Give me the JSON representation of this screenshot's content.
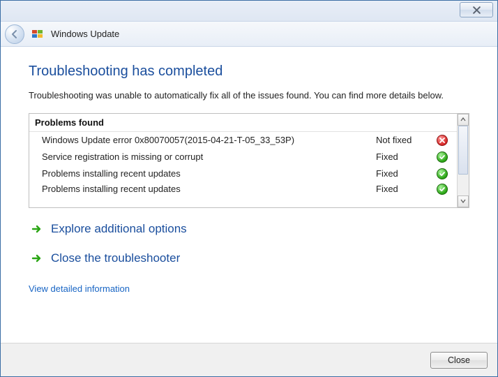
{
  "window": {
    "title": "Windows Update"
  },
  "main": {
    "heading": "Troubleshooting has completed",
    "body": "Troubleshooting was unable to automatically fix all of the issues found. You can find more details below."
  },
  "problems": {
    "header": "Problems found",
    "rows": [
      {
        "name": "Windows Update error 0x80070057(2015-04-21-T-05_33_53P)",
        "status": "Not fixed",
        "state": "error"
      },
      {
        "name": "Service registration is missing or corrupt",
        "status": "Fixed",
        "state": "ok"
      },
      {
        "name": "Problems installing recent updates",
        "status": "Fixed",
        "state": "ok"
      },
      {
        "name": "Problems installing recent updates",
        "status": "Fixed",
        "state": "ok"
      }
    ]
  },
  "actions": {
    "explore": "Explore additional options",
    "close_ts": "Close the troubleshooter",
    "details": "View detailed information"
  },
  "footer": {
    "close": "Close"
  },
  "icons": {
    "back": "back-arrow",
    "wu": "windows-update-flag",
    "close_x": "close-x",
    "arrow": "green-arrow-right",
    "error": "error-circle",
    "ok": "ok-circle",
    "sb_up": "scroll-up",
    "sb_down": "scroll-down"
  }
}
